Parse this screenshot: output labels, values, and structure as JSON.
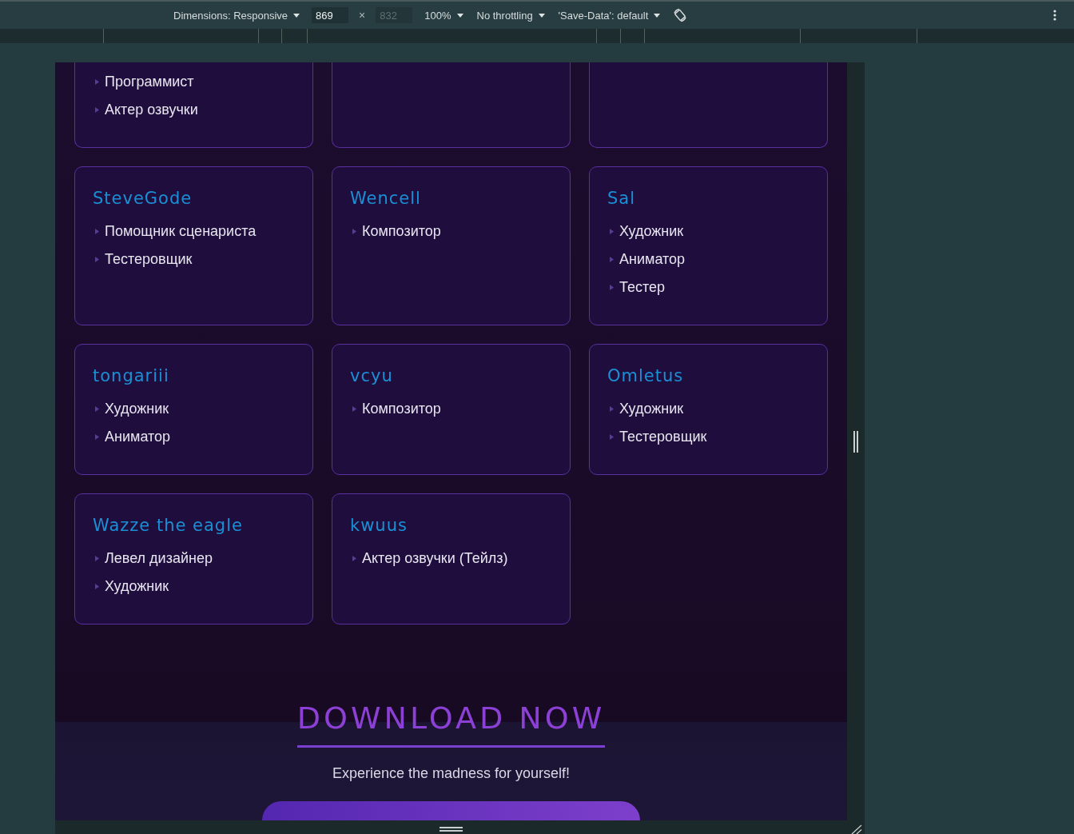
{
  "toolbar": {
    "items": [
      {
        "kind": "dropdown",
        "label": "Dimensions: Responsive"
      },
      {
        "kind": "field",
        "value": "869",
        "disabled": false
      },
      {
        "kind": "text",
        "label": "×"
      },
      {
        "kind": "field",
        "value": "832",
        "disabled": true
      },
      {
        "kind": "dropdown",
        "label": "100%"
      },
      {
        "kind": "dropdown",
        "label": "No throttling"
      },
      {
        "kind": "dropdown",
        "label": "'Save-Data': default"
      },
      {
        "kind": "rotate"
      }
    ]
  },
  "credits": {
    "cards": [
      {
        "kind": "partial",
        "roles": [
          "Программист",
          "Актер озвучки"
        ]
      },
      {
        "kind": "partial"
      },
      {
        "kind": "partial"
      },
      {
        "kind": "full",
        "name": "SteveGode",
        "roles": [
          "Помощник сценариста",
          "Тестеровщик"
        ]
      },
      {
        "kind": "full",
        "name": "Wencell",
        "roles": [
          "Композитор"
        ]
      },
      {
        "kind": "full",
        "name": "Sal",
        "roles": [
          "Художник",
          "Аниматор",
          "Тестер"
        ]
      },
      {
        "kind": "full",
        "name": "tongariii",
        "roles": [
          "Художник",
          "Аниматор"
        ]
      },
      {
        "kind": "full",
        "name": "vcyu",
        "roles": [
          "Композитор"
        ]
      },
      {
        "kind": "full",
        "name": "Omletus",
        "roles": [
          "Художник",
          "Тестеровщик"
        ]
      },
      {
        "kind": "full",
        "name": "Wazze the eagle",
        "roles": [
          "Левел дизайнер",
          "Художник"
        ]
      },
      {
        "kind": "full",
        "name": "kwuus",
        "roles": [
          "Актер озвучки (Тейлз)"
        ]
      }
    ]
  },
  "download": {
    "title": "DOWNLOAD NOW",
    "subtitle": "Experience the madness for yourself!"
  }
}
